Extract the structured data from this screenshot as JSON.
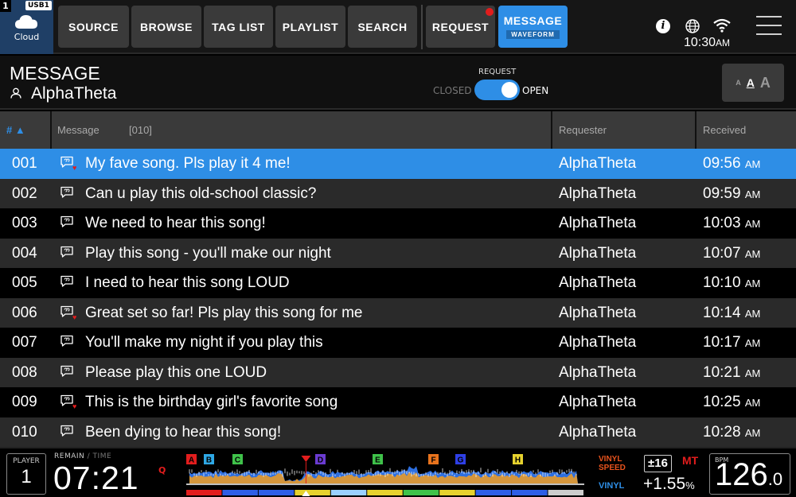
{
  "deck": {
    "number": "1",
    "usb": "USB1",
    "cloud_label": "Cloud"
  },
  "nav": {
    "source": "SOURCE",
    "browse": "BROWSE",
    "tag_list": "TAG LIST",
    "playlist": "PLAYLIST",
    "search": "SEARCH",
    "request": "REQUEST",
    "message": "MESSAGE",
    "message_sub": "WAVEFORM"
  },
  "status": {
    "clock": "10:30",
    "clock_ampm": "AM"
  },
  "header": {
    "title": "MESSAGE",
    "user": "AlphaTheta",
    "request_label": "REQUEST",
    "closed_label": "CLOSED",
    "open_label": "OPEN",
    "request_open": true,
    "font_small": "A",
    "font_medium": "A",
    "font_large": "A"
  },
  "table": {
    "headers": {
      "num": "# ▲",
      "message": "Message",
      "count": "[010]",
      "requester": "Requester",
      "received": "Received"
    },
    "rows": [
      {
        "num": "001",
        "message": "My fave song. Pls play it 4 me!",
        "requester": "AlphaTheta",
        "time": "09:56",
        "ampm": "AM",
        "liked": true,
        "selected": true
      },
      {
        "num": "002",
        "message": "Can u play this old-school classic?",
        "requester": "AlphaTheta",
        "time": "09:59",
        "ampm": "AM",
        "liked": false,
        "selected": false
      },
      {
        "num": "003",
        "message": "We need to hear this song!",
        "requester": "AlphaTheta",
        "time": "10:03",
        "ampm": "AM",
        "liked": false,
        "selected": false
      },
      {
        "num": "004",
        "message": "Play this song - you'll make our night",
        "requester": "AlphaTheta",
        "time": "10:07",
        "ampm": "AM",
        "liked": false,
        "selected": false
      },
      {
        "num": "005",
        "message": "I need to hear this song LOUD",
        "requester": "AlphaTheta",
        "time": "10:10",
        "ampm": "AM",
        "liked": false,
        "selected": false
      },
      {
        "num": "006",
        "message": "Great set so far! Pls play this song for me",
        "requester": "AlphaTheta",
        "time": "10:14",
        "ampm": "AM",
        "liked": true,
        "selected": false
      },
      {
        "num": "007",
        "message": "You'll make my night if you play this",
        "requester": "AlphaTheta",
        "time": "10:17",
        "ampm": "AM",
        "liked": false,
        "selected": false
      },
      {
        "num": "008",
        "message": "Please play this one LOUD",
        "requester": "AlphaTheta",
        "time": "10:21",
        "ampm": "AM",
        "liked": false,
        "selected": false
      },
      {
        "num": "009",
        "message": "This is the birthday girl's favorite song",
        "requester": "AlphaTheta",
        "time": "10:25",
        "ampm": "AM",
        "liked": true,
        "selected": false
      },
      {
        "num": "010",
        "message": "Been dying to hear this song!",
        "requester": "AlphaTheta",
        "time": "10:28",
        "ampm": "AM",
        "liked": false,
        "selected": false
      }
    ]
  },
  "player": {
    "label": "PLAYER",
    "number": "1",
    "remain_label": "REMAIN",
    "time_label": "TIME",
    "time_value": "07:21",
    "q_label": "Q",
    "vinyl_speed_1": "VINYL",
    "vinyl_speed_2": "SPEED",
    "vinyl_label": "VINYL",
    "tempo_range": "±16",
    "mt_label": "MT",
    "tempo_value": "+1.55",
    "tempo_unit": "%",
    "bpm_label": "BPM",
    "bpm_int": "126",
    "bpm_dec": ".0",
    "hot_cues": [
      {
        "letter": "A",
        "color": "#e21d1d"
      },
      {
        "letter": "B",
        "color": "#2ea8e6"
      },
      {
        "letter": "C",
        "color": "#3fc24a"
      },
      {
        "letter": "D",
        "color": "#6a3bd1"
      },
      {
        "letter": "E",
        "color": "#3fc24a"
      },
      {
        "letter": "F",
        "color": "#e8731d"
      },
      {
        "letter": "G",
        "color": "#2e3fe6"
      },
      {
        "letter": "H",
        "color": "#e6d22e"
      }
    ],
    "playback_progress": 0.3
  },
  "colors": {
    "accent": "#2e8ee6",
    "alert": "#e21d1d",
    "orange": "#e8731d"
  }
}
